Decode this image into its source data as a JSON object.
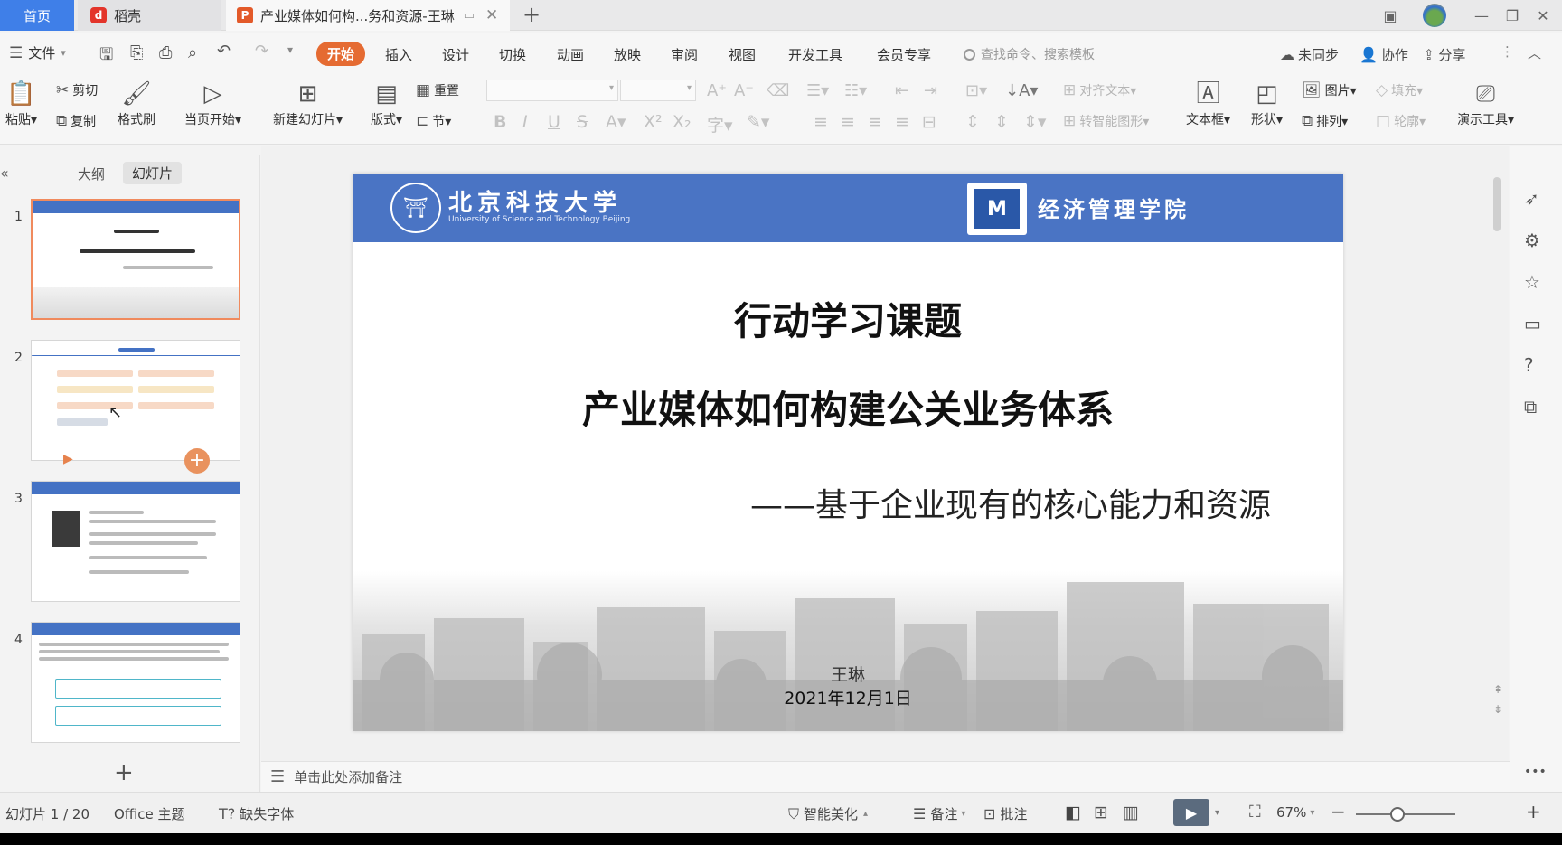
{
  "tabs": {
    "home": "首页",
    "docer": "稻壳",
    "document": "产业媒体如何构...务和资源-王琳"
  },
  "menu": {
    "file": "文件",
    "items": [
      "开始",
      "插入",
      "设计",
      "切换",
      "动画",
      "放映",
      "审阅",
      "视图",
      "开发工具",
      "会员专享"
    ],
    "search_placeholder": "查找命令、搜索模板",
    "unsynced": "未同步",
    "collab": "协作",
    "share": "分享"
  },
  "ribbon": {
    "paste": "粘贴",
    "cut": "剪切",
    "copy": "复制",
    "format_painter": "格式刷",
    "from_current": "当页开始",
    "new_slide": "新建幻灯片",
    "layout": "版式",
    "reset": "重置",
    "section": "节",
    "align_text": "对齐文本",
    "smart_art": "转智能图形",
    "textbox": "文本框",
    "shape": "形状",
    "picture": "图片",
    "fill": "填充",
    "arrange": "排列",
    "outline": "轮廓",
    "present_tools": "演示工具"
  },
  "panel": {
    "outline_tab": "大纲",
    "slides_tab": "幻灯片",
    "slide_numbers": [
      "1",
      "2",
      "3",
      "4"
    ]
  },
  "slide": {
    "university_cn": "北京科技大学",
    "university_en": "University of Science and Technology Beijing",
    "school": "经济管理学院",
    "title1": "行动学习课题",
    "title2": "产业媒体如何构建公关业务体系",
    "subtitle": "——基于企业现有的核心能力和资源",
    "author": "王琳",
    "date": "2021年12月1日"
  },
  "notes": {
    "placeholder": "单击此处添加备注"
  },
  "status": {
    "slide_counter": "幻灯片 1 / 20",
    "theme": "Office 主题",
    "missing_font": "缺失字体",
    "beautify": "智能美化",
    "notes": "备注",
    "comment": "批注",
    "zoom": "67%",
    "zoom_fraction": 0.42
  },
  "colors": {
    "accent": "#e56b32",
    "slide_header": "#4a74c4",
    "home_tab": "#3f7fe8"
  }
}
